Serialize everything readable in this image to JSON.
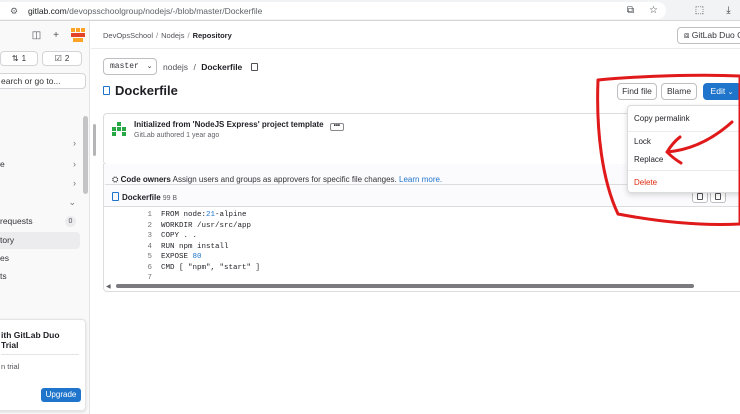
{
  "browser": {
    "url_host": "gitlab.com",
    "url_path": "/devopsschoolgroup/nodejs/-/blob/master/Dockerfile"
  },
  "sidebar": {
    "chips": [
      {
        "icon": "merge-request-icon",
        "count": "1"
      },
      {
        "icon": "todo-icon",
        "count": "2"
      }
    ],
    "search_placeholder": "earch or go to...",
    "items": [
      {
        "label": "",
        "chevron": "›"
      },
      {
        "label": "e",
        "chevron": "›"
      },
      {
        "label": "",
        "chevron": "›"
      },
      {
        "label": "",
        "chevron": "⌄"
      },
      {
        "label": "requests",
        "badge": "0"
      },
      {
        "label": "tory",
        "active": true
      },
      {
        "label": "es"
      },
      {
        "label": "ts"
      }
    ],
    "promo": {
      "title": "ith GitLab Duo\nTrial",
      "subtitle": "n trial",
      "button": "Upgrade"
    }
  },
  "breadcrumb": {
    "items": [
      "DevOpsSchool",
      "Nodejs",
      "Repository"
    ]
  },
  "header": {
    "duo_button": "GitLab Duo C"
  },
  "file_nav": {
    "branch": "master",
    "path_root": "nodejs",
    "path_file": "Dockerfile"
  },
  "file_title": "Dockerfile",
  "actions": {
    "find_file": "Find file",
    "blame": "Blame",
    "edit": "Edit"
  },
  "commit": {
    "title": "Initialized from 'NodeJS Express' project template",
    "more": "•••",
    "author_line": "GitLab authored 1 year ago"
  },
  "code_owners": {
    "label": "Code owners",
    "text": "Assign users and groups as approvers for specific file changes.",
    "link": "Learn more."
  },
  "file_box": {
    "name": "Dockerfile",
    "size": "99 B",
    "lines": [
      {
        "n": "1",
        "parts": [
          [
            "FROM node:",
            ""
          ],
          [
            "21",
            "num"
          ],
          [
            "-alpine",
            ""
          ]
        ]
      },
      {
        "n": "2",
        "parts": [
          [
            "WORKDIR /usr/src/app",
            ""
          ]
        ]
      },
      {
        "n": "3",
        "parts": [
          [
            "COPY . .",
            ""
          ]
        ]
      },
      {
        "n": "4",
        "parts": [
          [
            "RUN npm install",
            ""
          ]
        ]
      },
      {
        "n": "5",
        "parts": [
          [
            "EXPOSE ",
            ""
          ],
          [
            "80",
            "num"
          ]
        ]
      },
      {
        "n": "6",
        "parts": [
          [
            "CMD [ \"npm\", \"start\" ]",
            ""
          ]
        ]
      },
      {
        "n": "7",
        "parts": [
          [
            "",
            ""
          ]
        ]
      }
    ]
  },
  "edit_menu": {
    "items": [
      "Copy permalink",
      "Lock",
      "Replace",
      "Delete"
    ]
  },
  "colors": {
    "accent": "#1f75cb",
    "annotation": "#e0191b",
    "danger": "#dd2b0e"
  }
}
